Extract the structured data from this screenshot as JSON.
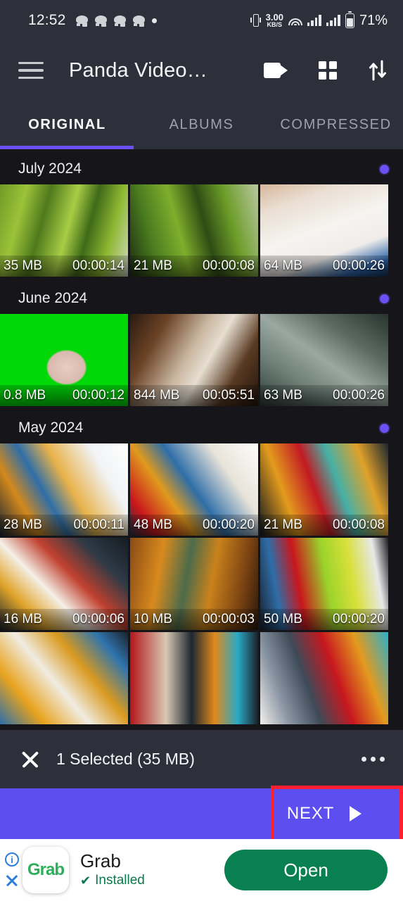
{
  "status_bar": {
    "time": "12:52",
    "notification_icons": [
      "message-notification-icon",
      "message-notification-icon",
      "message-notification-icon",
      "message-notification-icon",
      "dot-notification-icon"
    ],
    "vibrate_icon": "vibrate-icon",
    "net_speed_value": "3.00",
    "net_speed_unit": "KB/S",
    "wifi_icon": "wifi-icon",
    "signal_1": "signal-bars-icon",
    "signal_2": "signal-bars-icon",
    "battery_icon": "battery-icon",
    "battery_percent": "71%"
  },
  "app_bar": {
    "menu_icon": "hamburger-menu-icon",
    "title": "Panda Video…",
    "video_icon": "video-camera-icon",
    "grid_icon": "grid-view-icon",
    "sort_icon": "sort-icon"
  },
  "tabs": {
    "items": [
      {
        "label": "ORIGINAL",
        "active": true
      },
      {
        "label": "ALBUMS",
        "active": false
      },
      {
        "label": "COMPRESSED",
        "active": false
      }
    ],
    "accent_color": "#6c4ff7"
  },
  "sections": [
    {
      "title": "July 2024",
      "select_dot": "select-all-dot",
      "rows": [
        [
          {
            "size": "35 MB",
            "duration": "00:00:14",
            "selected": true,
            "art": "palm-trees-green"
          },
          {
            "size": "21 MB",
            "duration": "00:00:08",
            "selected": false,
            "art": "palm-fronds-green"
          },
          {
            "size": "64 MB",
            "duration": "00:00:26",
            "selected": false,
            "art": "paper-notebook-hand"
          }
        ]
      ]
    },
    {
      "title": "June 2024",
      "select_dot": "select-all-dot",
      "rows": [
        [
          {
            "size": "0.8 MB",
            "duration": "00:00:12",
            "selected": false,
            "art": "greenscreen-dog"
          },
          {
            "size": "844 MB",
            "duration": "00:05:51",
            "selected": false,
            "art": "parcel-on-stairs"
          },
          {
            "size": "63 MB",
            "duration": "00:00:26",
            "selected": false,
            "art": "dark-grass"
          }
        ]
      ]
    },
    {
      "title": "May 2024",
      "select_dot": "select-all-dot",
      "rows": [
        [
          {
            "size": "28 MB",
            "duration": "00:00:11",
            "selected": false,
            "art": "playground-a"
          },
          {
            "size": "48 MB",
            "duration": "00:00:20",
            "selected": false,
            "art": "playground-b"
          },
          {
            "size": "21 MB",
            "duration": "00:00:08",
            "selected": false,
            "art": "playground-c"
          }
        ],
        [
          {
            "size": "16 MB",
            "duration": "00:00:06",
            "selected": false,
            "art": "playground-d"
          },
          {
            "size": "10 MB",
            "duration": "00:00:03",
            "selected": false,
            "art": "playground-e"
          },
          {
            "size": "50 MB",
            "duration": "00:00:20",
            "selected": false,
            "art": "playground-f"
          }
        ],
        [
          {
            "size": "",
            "duration": "",
            "selected": false,
            "art": "playground-g",
            "clipped": true
          },
          {
            "size": "",
            "duration": "",
            "selected": false,
            "art": "playground-h",
            "clipped": true
          },
          {
            "size": "",
            "duration": "",
            "selected": false,
            "art": "playground-i",
            "clipped": true
          }
        ]
      ]
    }
  ],
  "selection_bar": {
    "close_icon": "close-icon",
    "label": "1 Selected (35 MB)",
    "overflow_icon": "overflow-menu-icon"
  },
  "next_bar": {
    "label": "NEXT",
    "arrow_icon": "play-arrow-icon",
    "background_color": "#5d4ef0",
    "highlight_color": "#ff1f2e"
  },
  "ad": {
    "info_icon": "info-icon",
    "close_icon": "ad-close-icon",
    "logo_text": "Grab",
    "title": "Grab",
    "check_icon": "check-icon",
    "status": "Installed",
    "button_label": "Open",
    "button_color": "#08804f"
  }
}
